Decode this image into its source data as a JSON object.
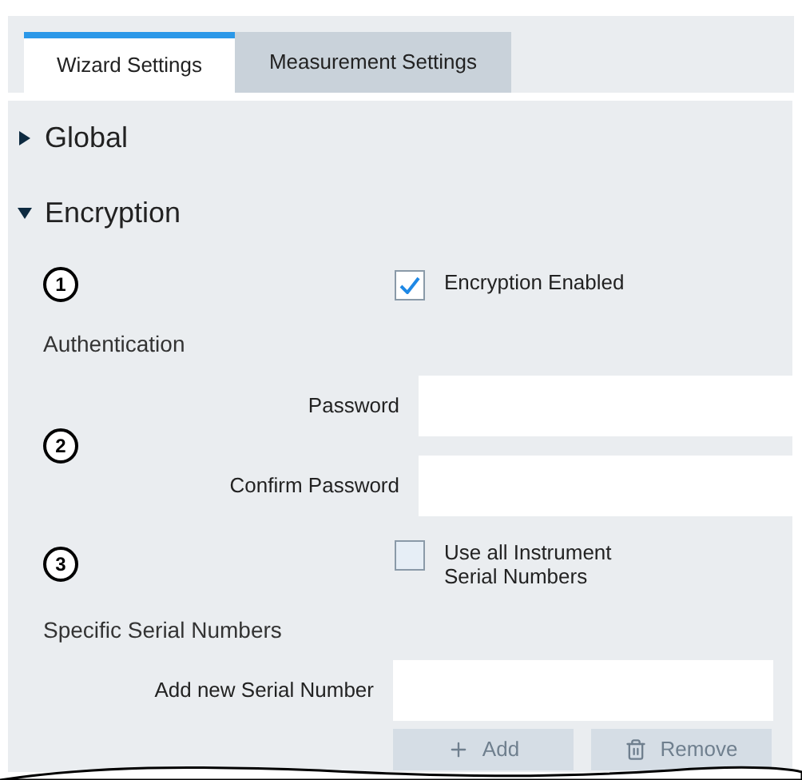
{
  "tabs": [
    {
      "label": "Wizard Settings",
      "selected": true
    },
    {
      "label": "Measurement Settings",
      "selected": false
    }
  ],
  "sections": [
    {
      "title": "Global",
      "expanded": false
    },
    {
      "title": "Encryption",
      "expanded": true
    }
  ],
  "encryption": {
    "marker_1": "1",
    "encryption_enabled": {
      "label": "Encryption Enabled",
      "checked": true
    },
    "authentication_heading": "Authentication",
    "marker_2": "2",
    "password": {
      "label": "Password"
    },
    "confirm_password": {
      "label": "Confirm Password"
    },
    "marker_3": "3",
    "use_all_serials": {
      "label": "Use all Instrument Serial Numbers",
      "checked": false
    },
    "specific_heading": "Specific Serial Numbers",
    "add_serial": {
      "label": "Add new Serial Number"
    },
    "buttons": [
      {
        "label": "Add",
        "kind": "add",
        "disabled": true
      },
      {
        "label": "Remove",
        "kind": "remove",
        "disabled": true
      }
    ]
  }
}
